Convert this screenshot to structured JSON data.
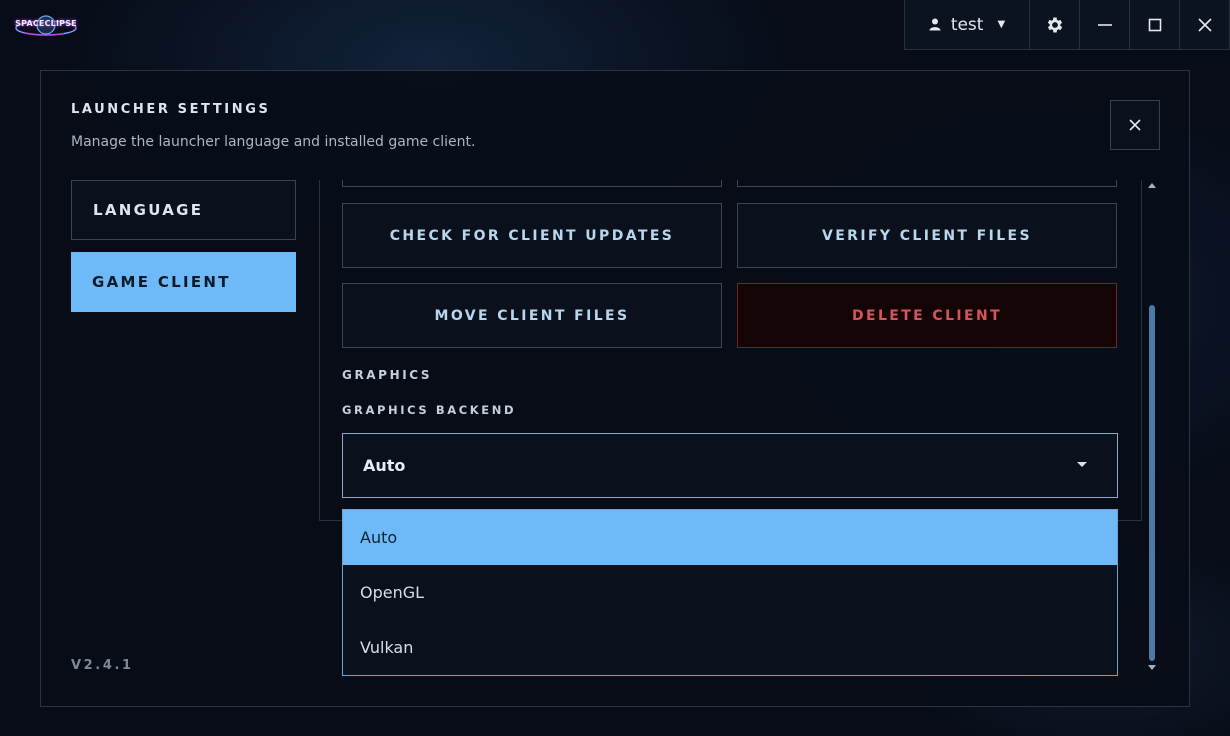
{
  "app": {
    "logo_text": "SPACECLIPSE",
    "user_name": "test"
  },
  "dialog": {
    "title": "LAUNCHER SETTINGS",
    "subtitle": "Manage the launcher language and installed game client.",
    "nav": [
      {
        "label": "LANGUAGE",
        "active": false
      },
      {
        "label": "GAME CLIENT",
        "active": true
      }
    ],
    "version": "V2.4.1"
  },
  "client": {
    "actions": [
      {
        "label": "CHECK FOR CLIENT UPDATES"
      },
      {
        "label": "VERIFY CLIENT FILES"
      },
      {
        "label": "MOVE CLIENT FILES"
      },
      {
        "label": "DELETE CLIENT"
      }
    ],
    "graphics_heading": "GRAPHICS",
    "backend_label": "GRAPHICS BACKEND",
    "backend_selected": "Auto",
    "backend_options": [
      "Auto",
      "OpenGL",
      "Vulkan"
    ]
  },
  "colors": {
    "accent": "#6ebaf8",
    "danger": "#d5555a"
  }
}
